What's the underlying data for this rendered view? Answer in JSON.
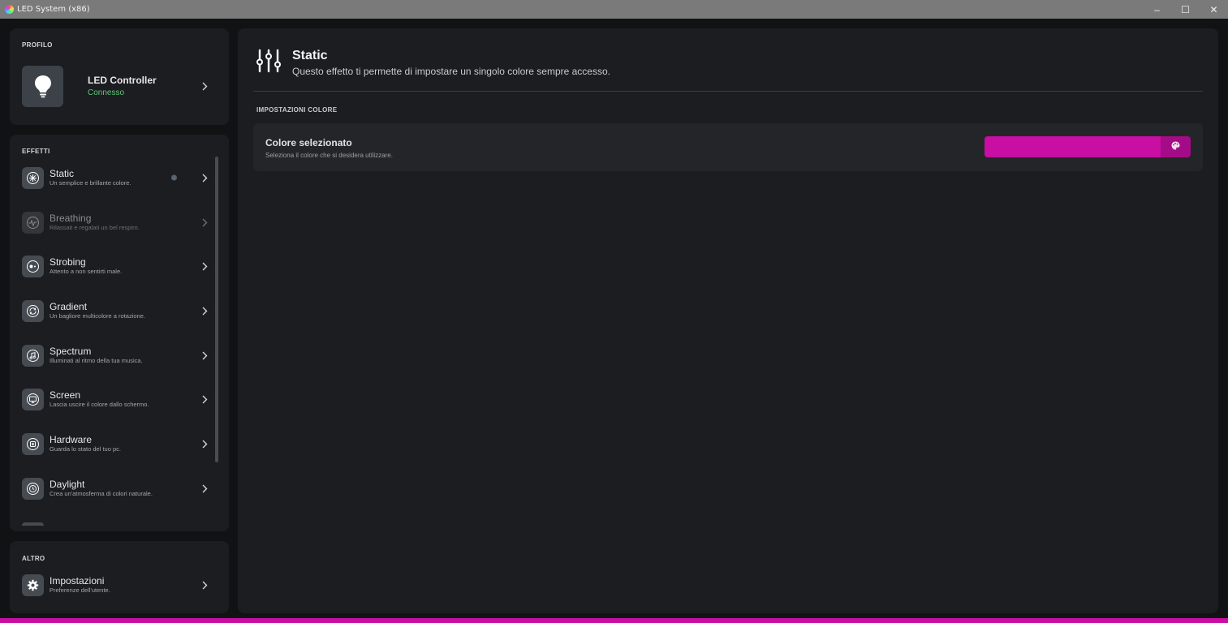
{
  "window": {
    "title": "LED System (x86)",
    "minimize": "–",
    "maximize": "☐",
    "close": "✕"
  },
  "colors": {
    "accent": "#c80ea3",
    "picker_button": "#a40b86",
    "status_ok": "#5cc77a"
  },
  "sidebar": {
    "profile": {
      "section_label": "PROFILO",
      "device_name": "LED Controller",
      "device_status": "Connesso",
      "icon": "lightbulb-icon"
    },
    "effects": {
      "section_label": "EFFETTI",
      "items": [
        {
          "name": "Static",
          "description": "Un semplice e brillante colore.",
          "icon": "static-icon",
          "active": true,
          "enabled": true
        },
        {
          "name": "Breathing",
          "description": "Rilassati e regalati un bel respiro.",
          "icon": "breathing-icon",
          "active": false,
          "enabled": false
        },
        {
          "name": "Strobing",
          "description": "Attento a non sentirti male.",
          "icon": "strobing-icon",
          "active": false,
          "enabled": true
        },
        {
          "name": "Gradient",
          "description": "Un bagliore multicolore a rotazione.",
          "icon": "gradient-icon",
          "active": false,
          "enabled": true
        },
        {
          "name": "Spectrum",
          "description": "Illuminati al ritmo della tua musica.",
          "icon": "music-note-icon",
          "active": false,
          "enabled": true
        },
        {
          "name": "Screen",
          "description": "Lascia uscire il colore dallo schermo.",
          "icon": "monitor-icon",
          "active": false,
          "enabled": true
        },
        {
          "name": "Hardware",
          "description": "Guarda lo stato del tuo pc.",
          "icon": "chip-icon",
          "active": false,
          "enabled": true
        },
        {
          "name": "Daylight",
          "description": "Crea un'atmosferma di colori naturale.",
          "icon": "clock-icon",
          "active": false,
          "enabled": true
        }
      ]
    },
    "other": {
      "section_label": "ALTRO",
      "items": [
        {
          "name": "Impostazioni",
          "description": "Preferenze dell'utente.",
          "icon": "gear-icon"
        }
      ]
    }
  },
  "main": {
    "title": "Static",
    "subtitle": "Questo effetto ti permette di impostare un singolo colore sempre accesso.",
    "header_icon": "sliders-icon",
    "section_label": "IMPOSTAZIONI COLORE",
    "setting": {
      "title": "Colore selezionato",
      "description": "Seleziona il colore che si desidera utilizzare.",
      "selected_color": "#c80ea3",
      "button_icon": "palette-icon"
    }
  }
}
